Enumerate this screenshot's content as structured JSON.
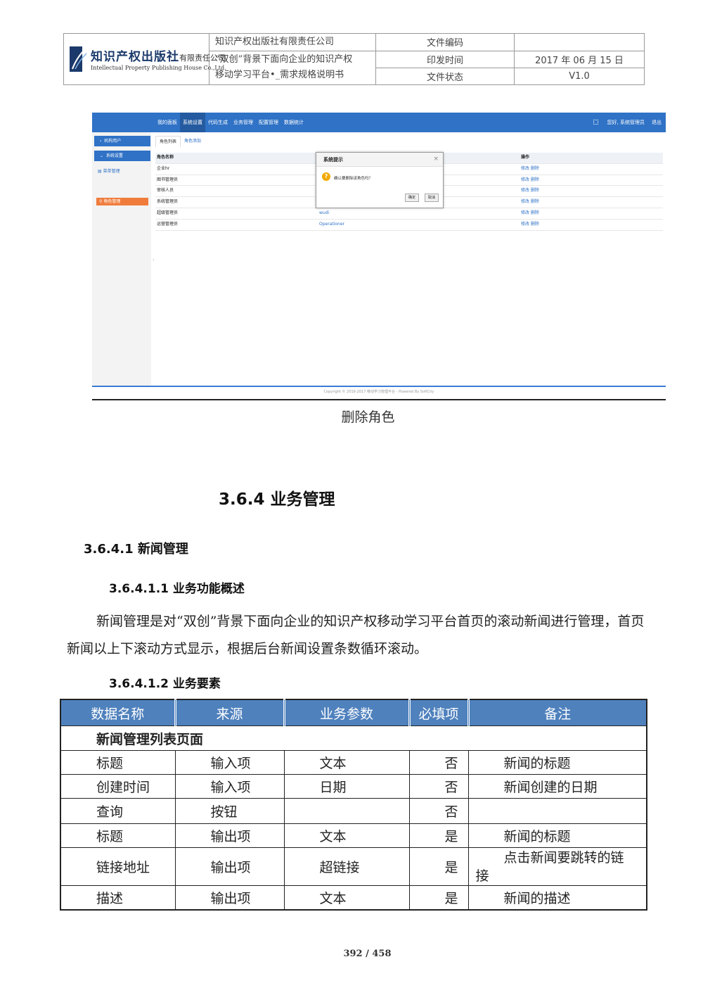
{
  "header": {
    "logo_cn": "知识产权出版社",
    "logo_cn_suffix": "有限责任公司",
    "logo_en": "Intellectual Property Publishing House Co.,Ltd.",
    "company": "知识产权出版社有限责任公司",
    "doc_title_1": "“双创”背景下面向企业的知识产权",
    "doc_title_2": "移动学习平台•_需求规格说明书",
    "label_code": "文件编码",
    "value_code": "",
    "label_date": "印发时间",
    "value_date": "2017 年 06 月 15 日",
    "label_status": "文件状态",
    "value_status": "V1.0"
  },
  "screenshot": {
    "nav": [
      "我的面板",
      "系统设置",
      "代码生成",
      "业务管理",
      "配置管理",
      "数据统计"
    ],
    "nav_active": 1,
    "user": "您好, 系统管理员",
    "logout": "退出",
    "sidebar": {
      "org_users": "机构用户",
      "system_settings": "系统设置",
      "menu_mgmt": "菜单管理",
      "role_mgmt": "角色管理"
    },
    "tabs": [
      "角色列表",
      "角色添加"
    ],
    "columns": [
      "角色名称",
      "",
      "操作"
    ],
    "rows": [
      {
        "name": "企业hr",
        "en": "",
        "ops": "修改 删除"
      },
      {
        "name": "图书管理员",
        "en": "",
        "ops": "修改 删除"
      },
      {
        "name": "审核人员",
        "en": "",
        "ops": "修改 删除"
      },
      {
        "name": "系统管理员",
        "en": "",
        "ops": "修改 删除"
      },
      {
        "name": "超级管理员",
        "en": "wudi",
        "ops": "修改 删除"
      },
      {
        "name": "运营管理员",
        "en": "Operationer",
        "ops": "修改 删除"
      }
    ],
    "dialog": {
      "title": "系统提示",
      "message": "确认要删除该角色吗？",
      "ok": "确定",
      "cancel": "取消"
    },
    "copyright": "Copyright © 2016-2017 移动学习管理平台 - Powered By SoftCity"
  },
  "caption": "删除角色",
  "section": {
    "h2": "3.6.4 业务管理",
    "h3": "3.6.4.1 新闻管理",
    "h4_overview": "3.6.4.1.1 业务功能概述",
    "paragraph": "新闻管理是对“双创”背景下面向企业的知识产权移动学习平台首页的滚动新闻进行管理，首页新闻以上下滚动方式显示，根据后台新闻设置条数循环滚动。",
    "h4_elements": "3.6.4.1.2 业务要素"
  },
  "elements_table": {
    "headers": [
      "数据名称",
      "来源",
      "业务参数",
      "必填项",
      "备注"
    ],
    "section_row": "新闻管理列表页面",
    "rows": [
      [
        "标题",
        "输入项",
        "文本",
        "否",
        "新闻的标题"
      ],
      [
        "创建时间",
        "输入项",
        "日期",
        "否",
        "新闻创建的日期"
      ],
      [
        "查询",
        "按钮",
        "",
        "否",
        ""
      ],
      [
        "标题",
        "输出项",
        "文本",
        "是",
        "新闻的标题"
      ],
      [
        "链接地址",
        "输出项",
        "超链接",
        "是",
        "点击新闻要跳转的链接"
      ],
      [
        "描述",
        "输出项",
        "文本",
        "是",
        "新闻的描述"
      ]
    ],
    "wrap_row": {
      "line1": "点击新闻要跳转的链",
      "line2": "接"
    }
  },
  "page_number": "392 / 458"
}
